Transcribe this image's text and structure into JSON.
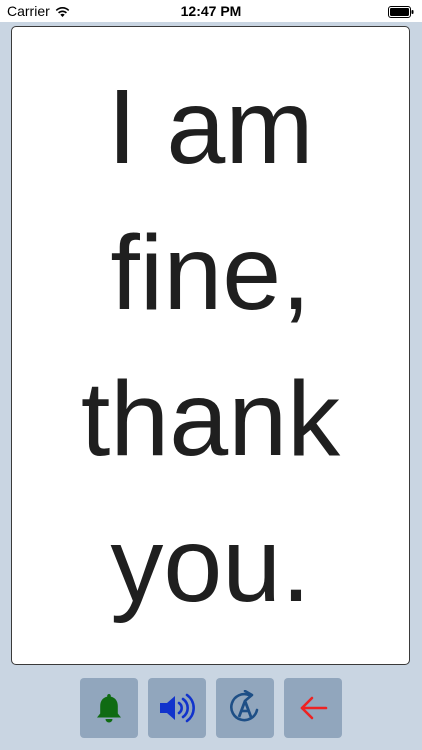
{
  "status_bar": {
    "carrier": "Carrier",
    "time": "12:47 PM"
  },
  "card": {
    "message_lines": [
      "I am",
      "fine,",
      "thank",
      "you."
    ]
  },
  "toolbar": {
    "buttons": [
      {
        "icon": "bell-icon",
        "color": "#0f6b12"
      },
      {
        "icon": "speaker-icon",
        "color": "#1133cc"
      },
      {
        "icon": "text-to-speech-icon",
        "color": "#1e4f86"
      },
      {
        "icon": "back-arrow-icon",
        "color": "#ee2222"
      }
    ]
  },
  "colors": {
    "background": "#c9d5e2",
    "button_bg": "#91a6bd",
    "card_text": "#1f1f1f"
  }
}
